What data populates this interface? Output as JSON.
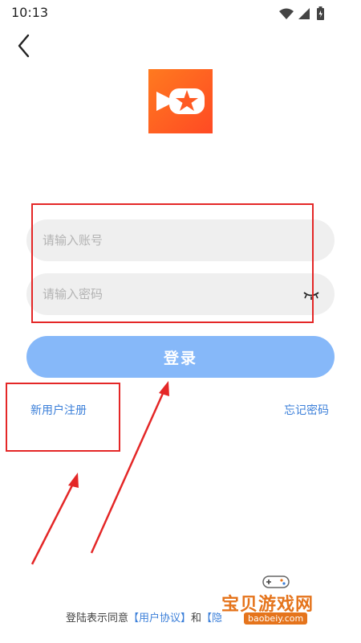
{
  "status_bar": {
    "time": "10:13",
    "icons": [
      "wifi-icon",
      "signal-icon",
      "battery-icon"
    ]
  },
  "nav": {
    "back_icon": "chevron-left-icon"
  },
  "app": {
    "logo_icon": "video-camera-star-logo",
    "brand_color": "#ff5a22"
  },
  "form": {
    "account_placeholder": "请输入账号",
    "password_placeholder": "请输入密码",
    "password_toggle_icon": "eye-closed-icon",
    "login_label": "登录",
    "login_color": "#86b8f9"
  },
  "links": {
    "register": "新用户注册",
    "forgot": "忘记密码",
    "color": "#3b7fd9"
  },
  "agreement": {
    "prefix": "登陆表示同意",
    "user_agreement": "【用户协议】",
    "and": "和",
    "privacy_partial": "【隐"
  },
  "annotations": {
    "color": "#e42727"
  },
  "watermark": {
    "text": "宝贝游戏网",
    "url": "baobeiy.com"
  }
}
